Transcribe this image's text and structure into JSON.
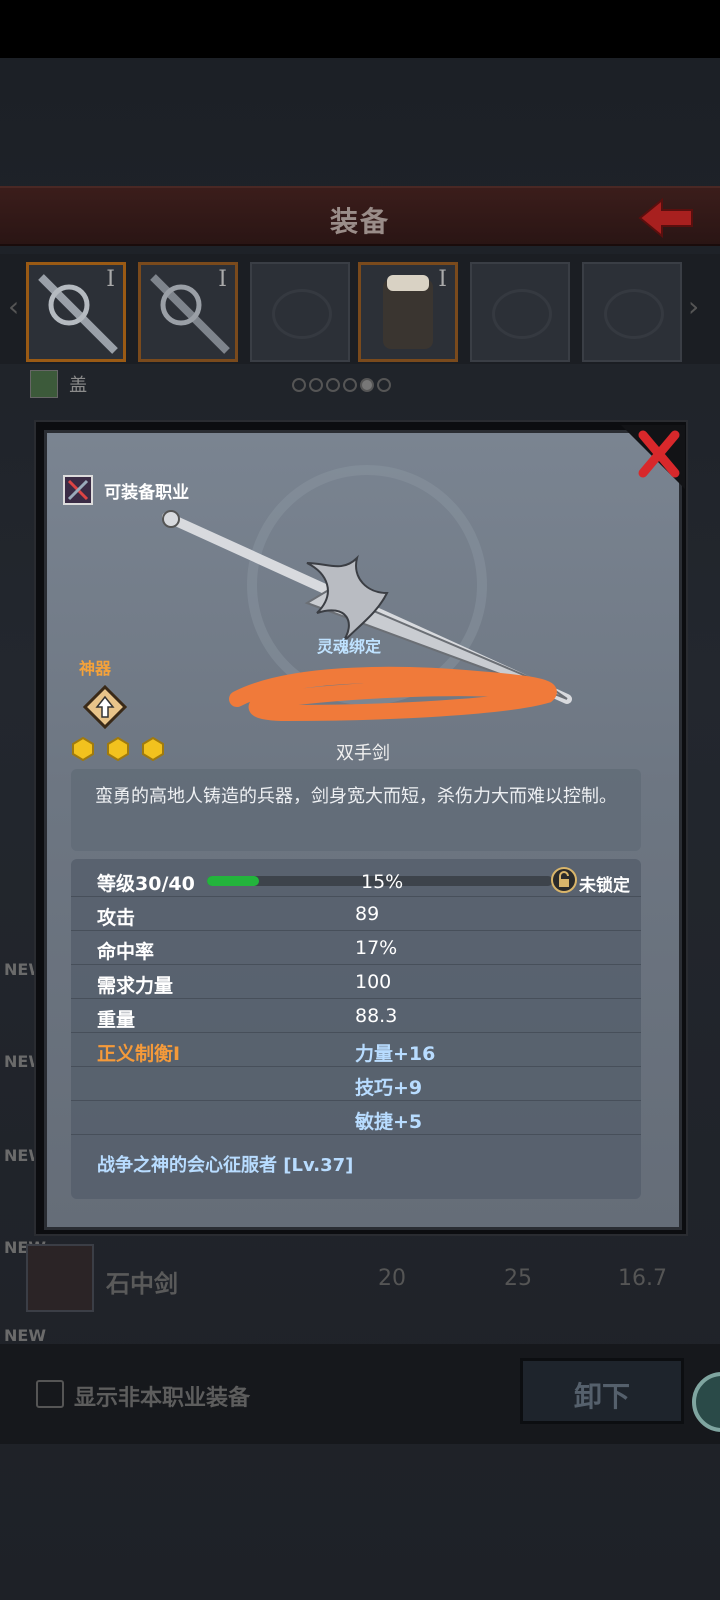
{
  "screen": {
    "header_title": "装备",
    "character_name": "盖",
    "page_dots": {
      "count": 6,
      "active": 4
    },
    "slots": [
      {
        "name": "weapon-slot-1",
        "tier": "I",
        "state": "selected"
      },
      {
        "name": "weapon-slot-2",
        "tier": "I",
        "state": "equipped"
      },
      {
        "name": "empty-slot-3",
        "tier": "",
        "state": "empty"
      },
      {
        "name": "armor-slot-4",
        "tier": "I",
        "state": "equipped"
      },
      {
        "name": "empty-slot-5",
        "tier": "",
        "state": "empty"
      },
      {
        "name": "empty-slot-6",
        "tier": "",
        "state": "empty"
      }
    ],
    "list_item": {
      "new_tag": "NEW",
      "name": "石中剑",
      "values": [
        "20",
        "25",
        "16.7"
      ]
    },
    "new_tags": [
      "NEW",
      "NEW",
      "NEW",
      "NEW"
    ],
    "show_other_class_label": "显示非本职业装备",
    "unequip_label": "卸下"
  },
  "item": {
    "class_label": "可装备职业",
    "artifact_label": "神器",
    "soul_bound_label": "灵魂绑定",
    "stars_count": 3,
    "type": "双手剑",
    "description": "蛮勇的高地人铸造的兵器，剑身宽大而短，杀伤力大而难以控制。",
    "level": {
      "label": "等级30/40",
      "progress_fraction": 0.15,
      "percent_text": "15%",
      "lock_label": "未锁定"
    },
    "stats": [
      {
        "key": "攻击",
        "value": "89"
      },
      {
        "key": "命中率",
        "value": "17%"
      },
      {
        "key": "需求力量",
        "value": "100"
      },
      {
        "key": "重量",
        "value": "88.3"
      }
    ],
    "set_bonus": {
      "name": "正义制衡I",
      "effects": [
        "力量+16",
        "技巧+9",
        "敏捷+5"
      ]
    },
    "skill": "战争之神的会心征服者 [Lv.37]"
  },
  "colors": {
    "accent_orange": "#f59a3a",
    "link_blue": "#b8dcff",
    "progress_green": "#23b43c",
    "close_red": "#d8282b"
  }
}
